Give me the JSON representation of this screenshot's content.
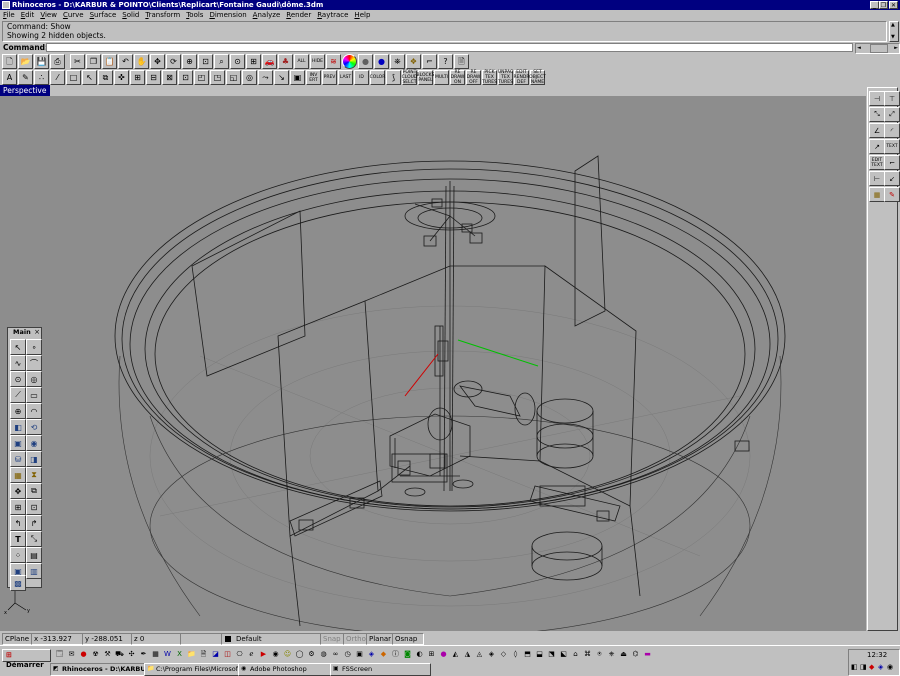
{
  "window": {
    "title": "Rhinoceros - D:\\KARBUR & POINTO\\Clients\\Replicart\\Fontaine Gaudi\\dôme.3dm",
    "min_label": "_",
    "max_label": "❐",
    "close_label": "✕"
  },
  "menu": [
    "File",
    "Edit",
    "View",
    "Curve",
    "Surface",
    "Solid",
    "Transform",
    "Tools",
    "Dimension",
    "Analyze",
    "Render",
    "Raytrace",
    "Help"
  ],
  "command_history": [
    "Command: Show",
    "Showing 2 hidden objects."
  ],
  "command_line": {
    "label": "Command:",
    "value": ""
  },
  "toolbar1": [
    "new-file-icon",
    "open-file-icon",
    "save-icon",
    "print-icon",
    "cut-icon",
    "copy-icon",
    "paste-icon",
    "undo-icon",
    "pan-hand-icon",
    "move-view-icon",
    "rotate-view-icon",
    "zoom-dynamic-icon",
    "zoom-window-icon",
    "zoom-extents-icon",
    "zoom-selected-icon",
    "four-view-icon",
    "car-icon",
    "tree-icon",
    "show-all-icon",
    "hide-icon",
    "layers-icon",
    "color-wheel-icon",
    "shade-icon",
    "render-sphere-icon",
    "lamp-icon",
    "properties-icon",
    "osnap-icon",
    "help-icon",
    "notes-icon"
  ],
  "toolbar1_text": {
    "show_all": "ALL",
    "hide": "HIDE"
  },
  "toolbar2": [
    "dim-icon",
    "pencil-icon",
    "points-icon",
    "lines-icon",
    "rect-icon",
    "pointer-icon",
    "boolean-icon",
    "block-icon",
    "grid-icon",
    "align-icon",
    "array-icon",
    "offset-icon",
    "project-icon",
    "mirror-icon",
    "sweep-icon",
    "loft-icon",
    "edit-icon"
  ],
  "toolbar2_text": {
    "invert": "INV\nERT",
    "prev": "PREV",
    "last": "LAST",
    "id": "ID",
    "color": "COLOR",
    "point_cloud": "POINT\nCLOUD\nSELCT",
    "blocks": "BLOCKS\nPANEL",
    "multi": "MULTI",
    "redraw_on": "RE\nDRAW\nON",
    "redraw_off": "RE\nDRAW\nOFF",
    "pick_textures": "PICK\nTEX\nTURES",
    "unpack": "UNPAC\nTEX\nTURES",
    "edit_render": "EDIT\nRENDR\nDEF",
    "set_object_name": "SET\nOBJECT\nNAME"
  },
  "viewport": {
    "title": "Perspective"
  },
  "right_toolbar_text": {
    "text": "TEXT",
    "edit_text": "EDIT\nTEXT"
  },
  "main_panel": {
    "title": "Main",
    "close": "×",
    "text_tool": "T"
  },
  "status": {
    "cplane": "CPlane",
    "x": "x -313.927",
    "y": "y -288.051",
    "z": "z 0",
    "layer": "Default",
    "snap": "Snap",
    "ortho": "Ortho",
    "planar": "Planar",
    "osnap": "Osnap"
  },
  "taskbar": {
    "start": "Démarrer",
    "tasks": [
      "Rhinoceros - D:\\KARBU...",
      "C:\\Program Files\\Microsoft...",
      "Adobe Photoshop",
      "FSScreen"
    ],
    "clock": "12:32"
  }
}
